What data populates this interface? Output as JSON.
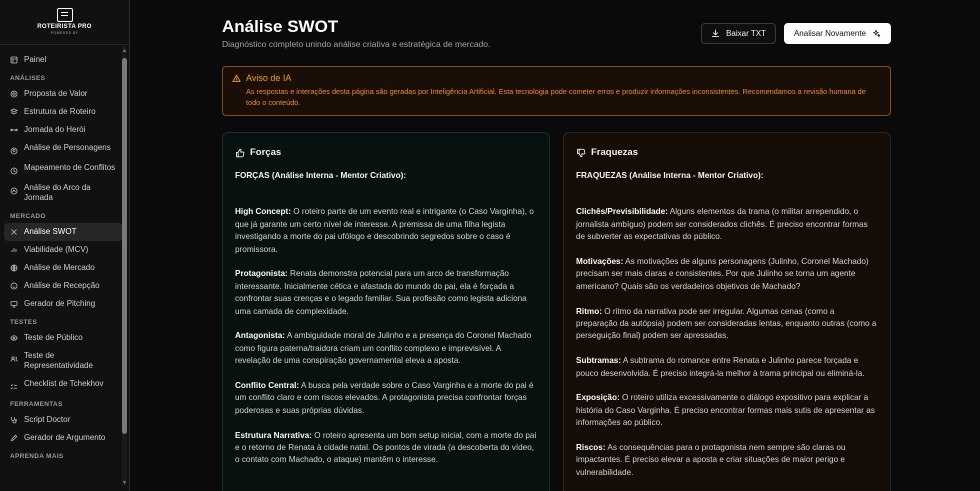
{
  "brand": {
    "title": "ROTEIRISTA PRO",
    "subtitle": "POWERED BY"
  },
  "sidebar": {
    "top": [
      {
        "label": "Painel",
        "icon": "layout-icon"
      }
    ],
    "sections": [
      {
        "title": "ANÁLISES",
        "items": [
          {
            "label": "Proposta de Valor",
            "icon": "target-icon"
          },
          {
            "label": "Estrutura de Roteiro",
            "icon": "layers-icon"
          },
          {
            "label": "Jornada do Herói",
            "icon": "route-icon"
          },
          {
            "label": "Análise de Personagens",
            "icon": "users-icon"
          },
          {
            "label": "Mapeamento de Conflitos",
            "icon": "swords-icon"
          },
          {
            "label": "Análise do Arco da Jornada",
            "icon": "trend-icon"
          }
        ]
      },
      {
        "title": "MERCADO",
        "items": [
          {
            "label": "Análise SWOT",
            "icon": "grid-icon",
            "active": true
          },
          {
            "label": "Viabilidade (MCV)",
            "icon": "dollar-icon"
          },
          {
            "label": "Análise de Mercado",
            "icon": "globe-icon"
          },
          {
            "label": "Análise de Recepção",
            "icon": "smile-icon"
          },
          {
            "label": "Gerador de Pitching",
            "icon": "presentation-icon"
          }
        ]
      },
      {
        "title": "TESTES",
        "items": [
          {
            "label": "Teste de Público",
            "icon": "eye-icon"
          },
          {
            "label": "Teste de Representatividade",
            "icon": "people-icon"
          },
          {
            "label": "Checklist de Tchekhov",
            "icon": "checklist-icon"
          }
        ]
      },
      {
        "title": "FERRAMENTAS",
        "items": [
          {
            "label": "Script Doctor",
            "icon": "stethoscope-icon"
          },
          {
            "label": "Gerador de Argumento",
            "icon": "pen-icon"
          }
        ]
      },
      {
        "title": "APRENDA MAIS",
        "items": []
      }
    ]
  },
  "header": {
    "title": "Análise SWOT",
    "subtitle": "Diagnóstico completo unindo análise criativa e estratégica de mercado.",
    "download_label": "Baixar TXT",
    "reanalyze_label": "Analisar Novamente"
  },
  "alert": {
    "title": "Aviso de IA",
    "body": "As respostas e interações desta página são geradas por Inteligência Artificial. Esta tecnologia pode cometer erros e produzir informações inconsistentes. Recomendamos a revisão humana de todo o conteúdo."
  },
  "strengths": {
    "title": "Forças",
    "heading": "FORÇAS (Análise Interna - Mentor Criativo):",
    "items": [
      {
        "term": "High Concept:",
        "text": " O roteiro parte de um evento real e intrigante (o Caso Varginha), o que já garante um certo nível de interesse. A premissa de uma filha legista investigando a morte do pai ufólogo e descobrindo segredos sobre o caso é promissora."
      },
      {
        "term": "Protagonista:",
        "text": " Renata demonstra potencial para um arco de transformação interessante. Inicialmente cética e afastada do mundo do pai, ela é forçada a confrontar suas crenças e o legado familiar. Sua profissão como legista adiciona uma camada de complexidade."
      },
      {
        "term": "Antagonista:",
        "text": " A ambiguidade moral de Julinho e a presença do Coronel Machado como figura paterna/traidora criam um conflito complexo e imprevisível. A revelação de uma conspiração governamental eleva a aposta."
      },
      {
        "term": "Conflito Central:",
        "text": " A busca pela verdade sobre o Caso Varginha e a morte do pai é um conflito claro e com riscos elevados. A protagonista precisa confrontar forças poderosas e suas próprias dúvidas."
      },
      {
        "term": "Estrutura Narrativa:",
        "text": " O roteiro apresenta um bom setup inicial, com a morte do pai e o retorno de Renata à cidade natal. Os pontos de virada (a descoberta do vídeo, o contato com Machado, o ataque) mantêm o interesse."
      }
    ]
  },
  "weaknesses": {
    "title": "Fraquezas",
    "heading": "FRAQUEZAS (Análise Interna - Mentor Criativo):",
    "items": [
      {
        "term": "Clichês/Previsibilidade:",
        "text": " Alguns elementos da trama (o militar arrependido, o jornalista ambíguo) podem ser considerados clichês. É preciso encontrar formas de subverter as expectativas do público."
      },
      {
        "term": "Motivações:",
        "text": " As motivações de alguns personagens (Julinho, Coronel Machado) precisam ser mais claras e consistentes. Por que Julinho se torna um agente americano? Quais são os verdadeiros objetivos de Machado?"
      },
      {
        "term": "Ritmo:",
        "text": " O ritmo da narrativa pode ser irregular. Algumas cenas (como a preparação da autópsia) podem ser consideradas lentas, enquanto outras (como a perseguição final) podem ser apressadas."
      },
      {
        "term": "Subtramas:",
        "text": " A subtrama do romance entre Renata e Julinho parece forçada e pouco desenvolvida. É preciso integrá-la melhor à trama principal ou eliminá-la."
      },
      {
        "term": "Exposição:",
        "text": " O roteiro utiliza excessivamente o diálogo expositivo para explicar a história do Caso Varginha. É preciso encontrar formas mais sutis de apresentar as informações ao público."
      },
      {
        "term": "Riscos:",
        "text": " As consequências para o protagonista nem sempre são claras ou impactantes. É preciso elevar a aposta e criar situações de maior perigo e vulnerabilidade."
      }
    ]
  }
}
